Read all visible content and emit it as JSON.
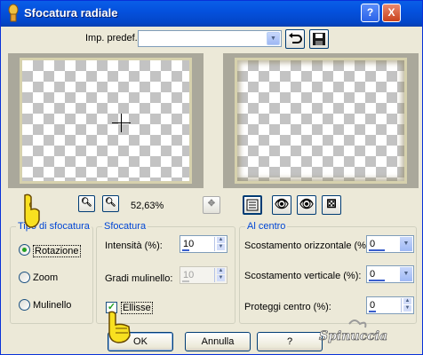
{
  "window": {
    "title": "Sfocatura radiale",
    "help_label": "?",
    "close_label": "X"
  },
  "preset": {
    "label": "Imp. predef.:",
    "value": ""
  },
  "zoom": {
    "percent": "52,63%"
  },
  "tipo": {
    "title": "Tipo di sfocatura",
    "options": [
      "Rotazione",
      "Zoom",
      "Mulinello"
    ],
    "selected": "Rotazione"
  },
  "sfocatura": {
    "title": "Sfocatura",
    "intensita_label": "Intensità (%):",
    "intensita_value": "10",
    "gradi_label": "Gradi mulinello:",
    "gradi_value": "10",
    "ellisse_label": "Ellisse",
    "ellisse_checked": true
  },
  "centro": {
    "title": "Al centro",
    "oriz_label": "Scostamento orizzontale (%):",
    "oriz_value": "0",
    "vert_label": "Scostamento verticale (%):",
    "vert_value": "0",
    "proteggi_label": "Proteggi centro (%):",
    "proteggi_value": "0"
  },
  "buttons": {
    "ok": "OK",
    "annulla": "Annulla",
    "help": "?"
  },
  "watermark": {
    "text": "Spinuccia"
  },
  "colors": {
    "titlebar": "#0451dd",
    "dialog_bg": "#ece9d8",
    "group_title": "#0046d5"
  }
}
